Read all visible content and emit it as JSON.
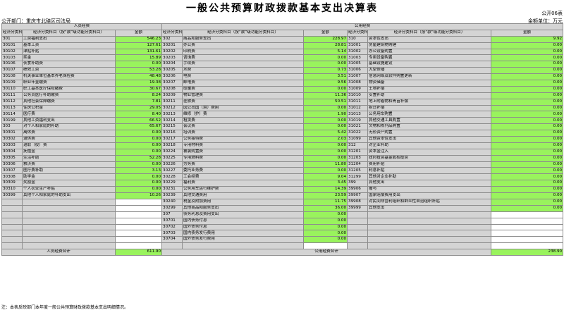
{
  "title": "一般公共预算财政拨款基本支出决算表",
  "form_no": "公开06表",
  "department": "公开部门：重庆市北碚区司法局",
  "unit": "金额单位：万元",
  "headers": {
    "personnel": "人员经费",
    "public": "公用经费",
    "code": "经济分类科目编码",
    "name": "经济分类科目（按“款”级功能分类科目）",
    "amount": "金额"
  },
  "personnel_rows": [
    {
      "code": "301",
      "name": "工资福利支出",
      "amount": "546.23"
    },
    {
      "code": "30101",
      "name": "基本工资",
      "amount": "127.61"
    },
    {
      "code": "30102",
      "name": "津贴补贴",
      "amount": "131.61"
    },
    {
      "code": "30103",
      "name": "奖金",
      "amount": "15.89"
    },
    {
      "code": "30106",
      "name": "伙食补助费",
      "amount": "0.00"
    },
    {
      "code": "30107",
      "name": "绩效工资",
      "amount": "53.28"
    },
    {
      "code": "30108",
      "name": "机关事业单位基本养老保险费",
      "amount": "48.48"
    },
    {
      "code": "30109",
      "name": "职业年金缴费",
      "amount": "19.38"
    },
    {
      "code": "30110",
      "name": "职工基本医疗保险缴费",
      "amount": "30.67"
    },
    {
      "code": "30111",
      "name": "公务员医疗补助缴费",
      "amount": "8.24"
    },
    {
      "code": "30112",
      "name": "其他社会保障缴费",
      "amount": "7.81"
    },
    {
      "code": "30113",
      "name": "住房公积金",
      "amount": "29.05"
    },
    {
      "code": "30114",
      "name": "医疗费",
      "amount": "8.40"
    },
    {
      "code": "30199",
      "name": "其他工资福利支出",
      "amount": "66.52"
    },
    {
      "code": "303",
      "name": "对个人和家庭的补助",
      "amount": "65.67"
    },
    {
      "code": "30301",
      "name": "离休费",
      "amount": "0.00"
    },
    {
      "code": "30302",
      "name": "退休费",
      "amount": "0.00"
    },
    {
      "code": "30303",
      "name": "退职（役）费",
      "amount": "0.00"
    },
    {
      "code": "30304",
      "name": "抚恤金",
      "amount": "0.00"
    },
    {
      "code": "30305",
      "name": "生活补助",
      "amount": "52.28"
    },
    {
      "code": "30306",
      "name": "救济费",
      "amount": "0.00"
    },
    {
      "code": "30307",
      "name": "医疗费补助",
      "amount": "3.13"
    },
    {
      "code": "30308",
      "name": "助学金",
      "amount": "0.00"
    },
    {
      "code": "30309",
      "name": "奖励金",
      "amount": "0.00"
    },
    {
      "code": "30310",
      "name": "个人农业生产补贴",
      "amount": "0.00"
    },
    {
      "code": "30399",
      "name": "其他个人和家庭的补助支出",
      "amount": "10.26"
    },
    {
      "code": "",
      "name": "",
      "amount": ""
    },
    {
      "code": "",
      "name": "",
      "amount": ""
    },
    {
      "code": "",
      "name": "",
      "amount": ""
    },
    {
      "code": "",
      "name": "",
      "amount": ""
    },
    {
      "code": "",
      "name": "",
      "amount": ""
    },
    {
      "code": "",
      "name": "",
      "amount": ""
    },
    {
      "code": "",
      "name": "",
      "amount": ""
    },
    {
      "code": "",
      "name": "",
      "amount": ""
    }
  ],
  "public_mid_rows": [
    {
      "code": "302",
      "name": "商品和服务支出",
      "amount": "228.97"
    },
    {
      "code": "30201",
      "name": "办公费",
      "amount": "28.81"
    },
    {
      "code": "30202",
      "name": "印刷费",
      "amount": "5.14"
    },
    {
      "code": "30203",
      "name": "咨询费",
      "amount": "0.00"
    },
    {
      "code": "30204",
      "name": "手续费",
      "amount": "0.00"
    },
    {
      "code": "30205",
      "name": "水费",
      "amount": "0.73"
    },
    {
      "code": "30206",
      "name": "电费",
      "amount": "3.51"
    },
    {
      "code": "30207",
      "name": "邮电费",
      "amount": "9.56"
    },
    {
      "code": "30208",
      "name": "取暖费",
      "amount": "0.00"
    },
    {
      "code": "30209",
      "name": "物业管理费",
      "amount": "11.36"
    },
    {
      "code": "30211",
      "name": "差旅费",
      "amount": "50.51"
    },
    {
      "code": "30212",
      "name": "因公出国（境）费用",
      "amount": "0.00"
    },
    {
      "code": "30213",
      "name": "维修（护）费",
      "amount": "1.90"
    },
    {
      "code": "30214",
      "name": "租赁费",
      "amount": "0.00"
    },
    {
      "code": "30215",
      "name": "会议费",
      "amount": "0.00"
    },
    {
      "code": "30216",
      "name": "培训费",
      "amount": "5.42"
    },
    {
      "code": "30217",
      "name": "公务接待费",
      "amount": "2.03"
    },
    {
      "code": "30218",
      "name": "专用材料费",
      "amount": "0.00"
    },
    {
      "code": "30224",
      "name": "被装购置费",
      "amount": "0.00"
    },
    {
      "code": "30225",
      "name": "专用燃料费",
      "amount": "0.00"
    },
    {
      "code": "30226",
      "name": "劳务费",
      "amount": "11.80"
    },
    {
      "code": "30227",
      "name": "委托业务费",
      "amount": "0.00"
    },
    {
      "code": "30228",
      "name": "工会经费",
      "amount": "9.04"
    },
    {
      "code": "30229",
      "name": "福利费",
      "amount": "3.45"
    },
    {
      "code": "30231",
      "name": "公务用车运行维护费",
      "amount": "14.39"
    },
    {
      "code": "30239",
      "name": "其他交通费用",
      "amount": "23.59"
    },
    {
      "code": "30240",
      "name": "税金及附加费用",
      "amount": "11.75"
    },
    {
      "code": "30299",
      "name": "其他商品和服务支出",
      "amount": "36.00"
    },
    {
      "code": "307",
      "name": "债务利息及费用支出",
      "amount": "0.00"
    },
    {
      "code": "30701",
      "name": "国内债务付息",
      "amount": "0.00"
    },
    {
      "code": "30702",
      "name": "国外债务付息",
      "amount": "0.00"
    },
    {
      "code": "30703",
      "name": "国内债务发行费用",
      "amount": "0.00"
    },
    {
      "code": "30704",
      "name": "国外债务发行费用",
      "amount": "0.00"
    },
    {
      "code": "",
      "name": "",
      "amount": ""
    }
  ],
  "public_right_rows": [
    {
      "code": "310",
      "name": "资本性支出",
      "amount": "9.92"
    },
    {
      "code": "31001",
      "name": "房屋建筑物购建",
      "amount": "0.00"
    },
    {
      "code": "31002",
      "name": "办公设备购置",
      "amount": "0.00"
    },
    {
      "code": "31003",
      "name": "专用设备购置",
      "amount": "0.00"
    },
    {
      "code": "31005",
      "name": "基础设施建设",
      "amount": "0.00"
    },
    {
      "code": "31006",
      "name": "大型修缮",
      "amount": "0.00"
    },
    {
      "code": "31007",
      "name": "信息网络及软件购置更新",
      "amount": "0.00"
    },
    {
      "code": "31008",
      "name": "物资储备",
      "amount": "0.00"
    },
    {
      "code": "31009",
      "name": "土地补偿",
      "amount": "0.00"
    },
    {
      "code": "31010",
      "name": "安置补助",
      "amount": "0.00"
    },
    {
      "code": "31011",
      "name": "地上附着物和青苗补偿",
      "amount": "0.00"
    },
    {
      "code": "31012",
      "name": "拆迁补偿",
      "amount": "0.00"
    },
    {
      "code": "31013",
      "name": "公务用车购置",
      "amount": "0.00"
    },
    {
      "code": "31019",
      "name": "其他交通工具购置",
      "amount": "0.00"
    },
    {
      "code": "31021",
      "name": "文物和陈列品购置",
      "amount": "0.00"
    },
    {
      "code": "31022",
      "name": "无形资产购置",
      "amount": "0.00"
    },
    {
      "code": "31099",
      "name": "其他资本性支出",
      "amount": "0.00"
    },
    {
      "code": "312",
      "name": "对企业补助",
      "amount": "0.00"
    },
    {
      "code": "31201",
      "name": "资本金注入",
      "amount": "0.00"
    },
    {
      "code": "31203",
      "name": "政府投资基金股权投资",
      "amount": "0.00"
    },
    {
      "code": "31204",
      "name": "费用补贴",
      "amount": "0.00"
    },
    {
      "code": "31205",
      "name": "利息补贴",
      "amount": "0.00"
    },
    {
      "code": "31299",
      "name": "其他对企业补助",
      "amount": "0.00"
    },
    {
      "code": "399",
      "name": "其他支出",
      "amount": "0.00"
    },
    {
      "code": "39906",
      "name": "赠与",
      "amount": "0.00"
    },
    {
      "code": "39907",
      "name": "国家赔偿费用支出",
      "amount": "0.00"
    },
    {
      "code": "39908",
      "name": "对民间非营利组织和群众性自治组织补贴",
      "amount": "0.00"
    },
    {
      "code": "39999",
      "name": "其他支出",
      "amount": "0.00"
    },
    {
      "code": "",
      "name": "",
      "amount": ""
    },
    {
      "code": "",
      "name": "",
      "amount": ""
    },
    {
      "code": "",
      "name": "",
      "amount": ""
    },
    {
      "code": "",
      "name": "",
      "amount": ""
    },
    {
      "code": "",
      "name": "",
      "amount": ""
    },
    {
      "code": "",
      "name": "",
      "amount": ""
    }
  ],
  "totals": {
    "personnel_label": "人员经费合计",
    "personnel_value": "611.90",
    "public_label": "公用经费合计",
    "public_value": "238.90"
  },
  "note": "注：本表反映部门本年度一般公共预算财政拨款基本支出明细情况。"
}
